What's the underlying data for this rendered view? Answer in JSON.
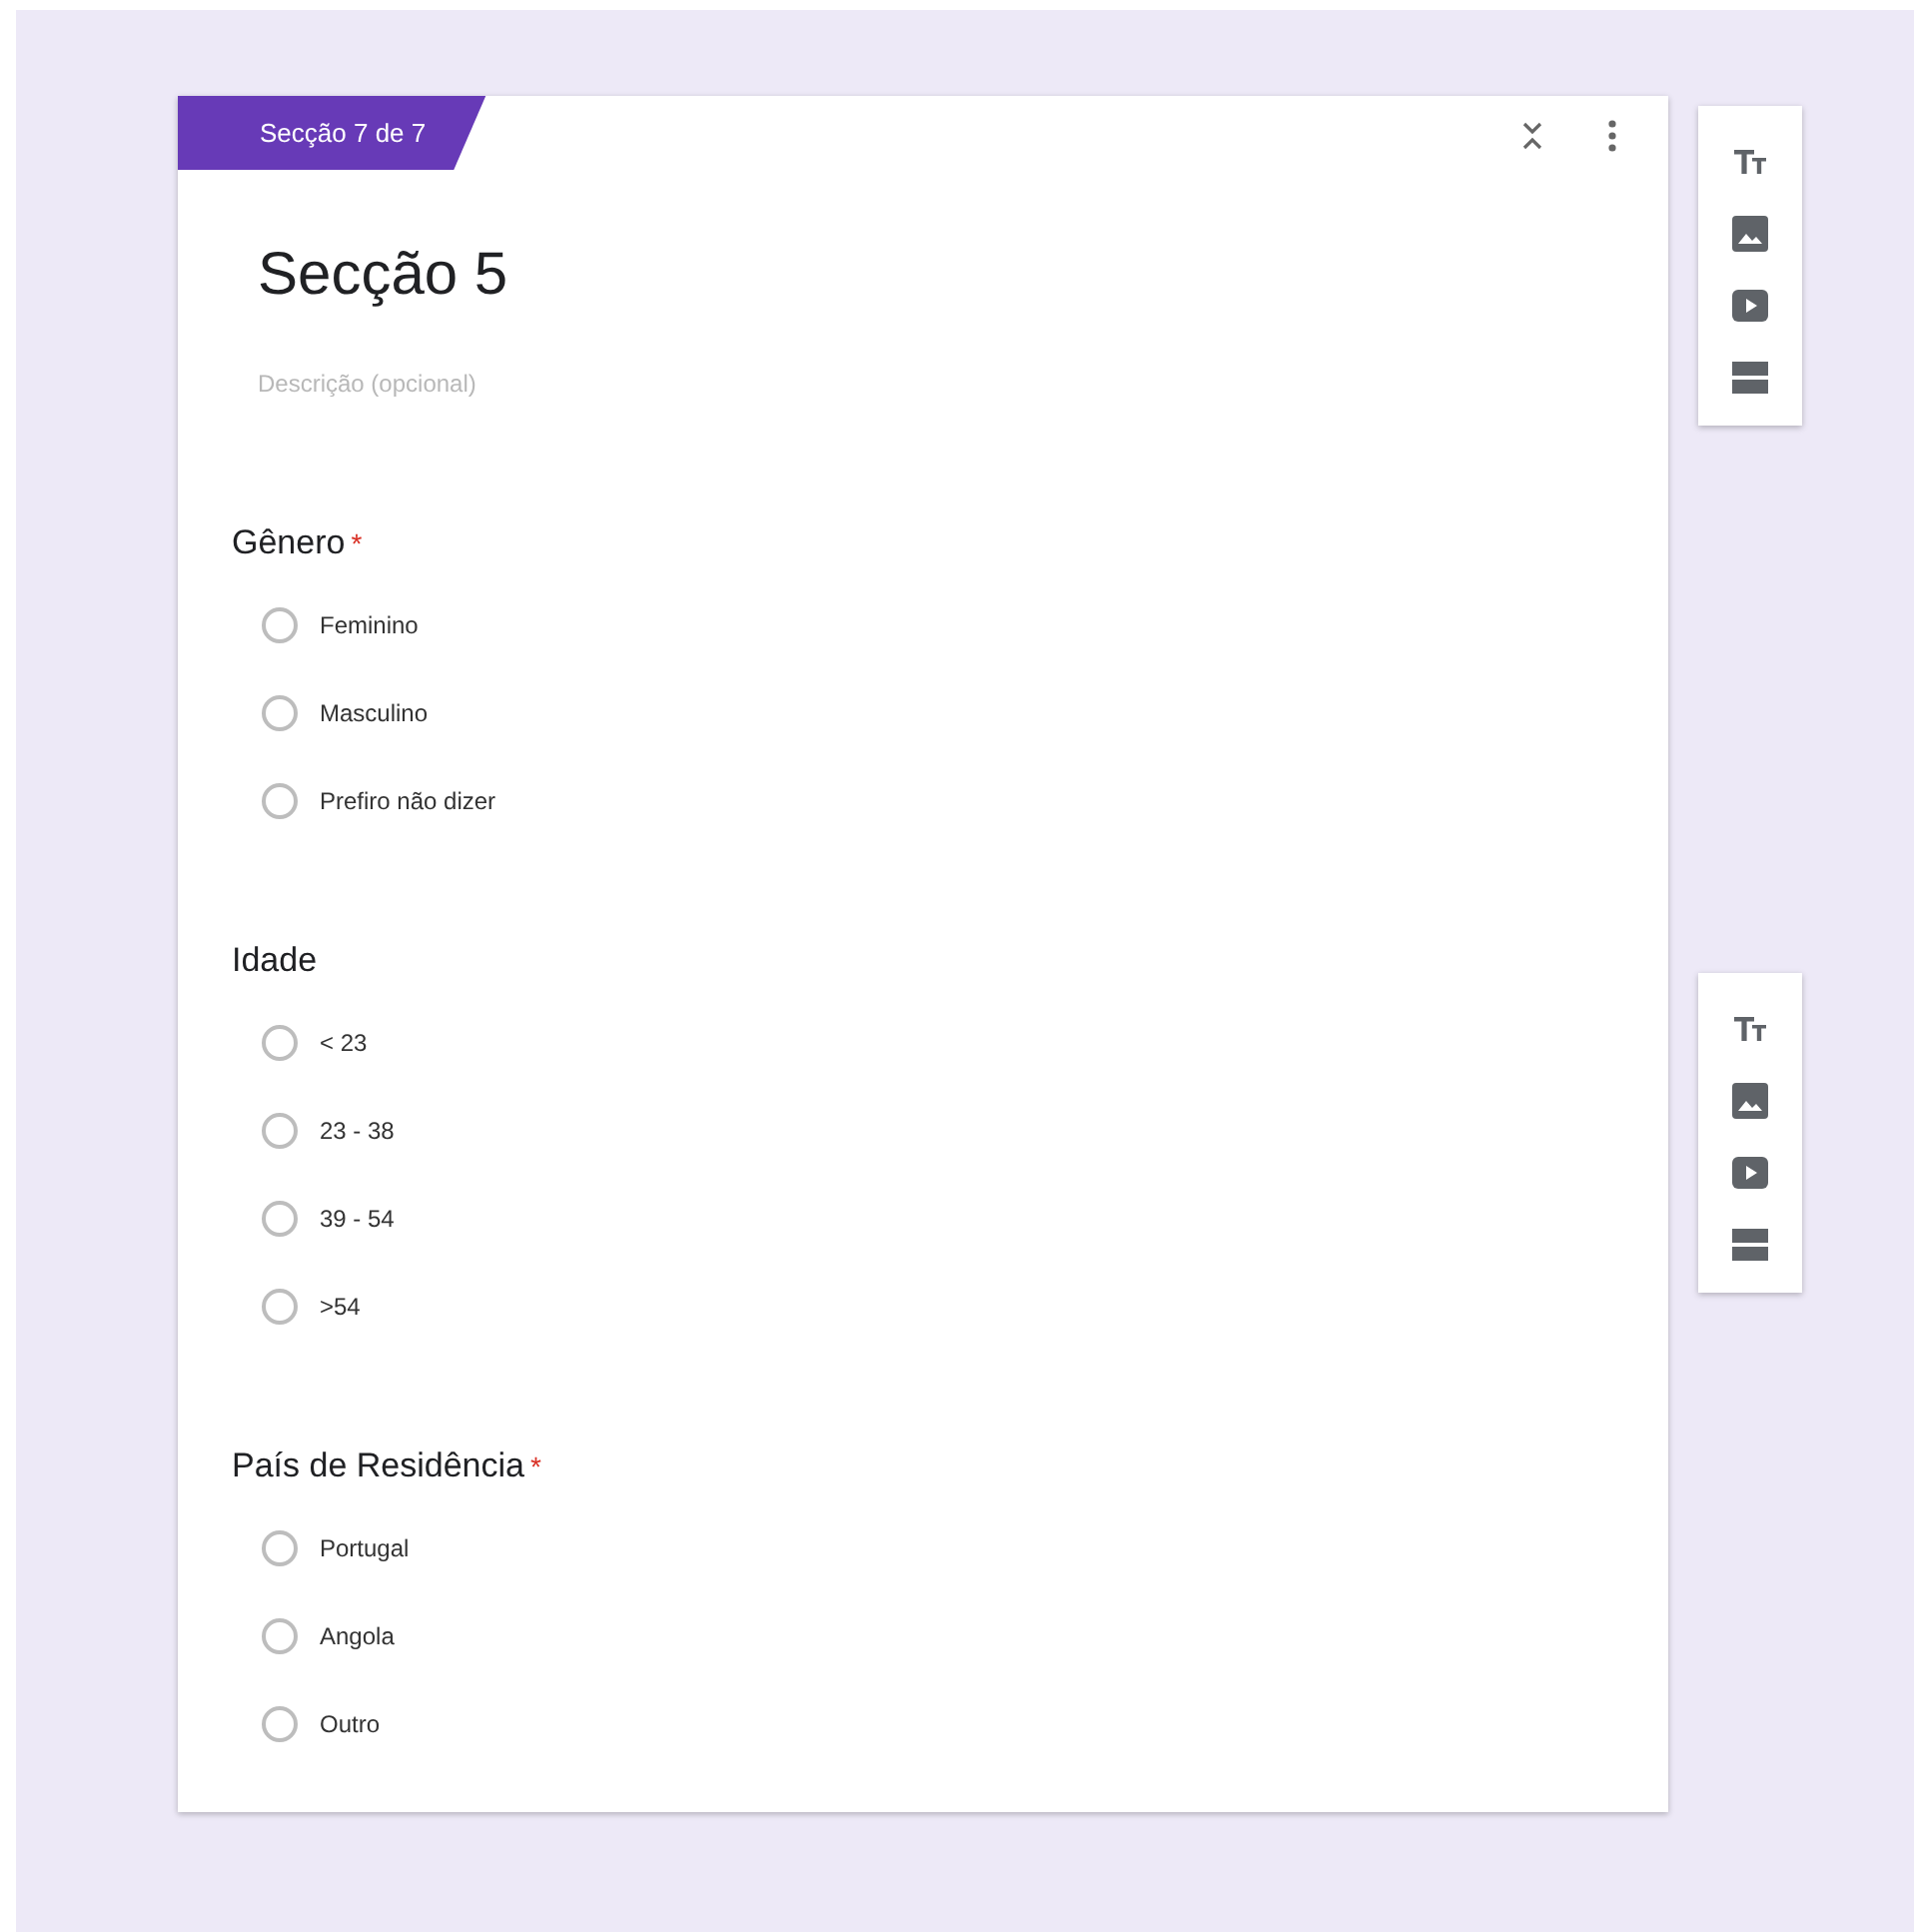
{
  "section_tab": {
    "label": "Secção 7 de 7"
  },
  "section": {
    "title": "Secção 5",
    "description": {
      "placeholder": "Descrição (opcional)"
    }
  },
  "questions": [
    {
      "title": "Gênero",
      "required_mark": "*",
      "options": [
        {
          "label": "Feminino",
          "selected": false
        },
        {
          "label": "Masculino",
          "selected": false
        },
        {
          "label": "Prefiro não dizer",
          "selected": false
        }
      ]
    },
    {
      "title": "Idade",
      "options": [
        {
          "label": "< 23",
          "selected": false
        },
        {
          "label": "23 - 38",
          "selected": false
        },
        {
          "label": "39 - 54",
          "selected": false
        },
        {
          "label": ">54",
          "selected": false
        }
      ]
    },
    {
      "title": "País de Residência",
      "required_mark": "*",
      "options": [
        {
          "label": "Portugal",
          "selected": false
        },
        {
          "label": "Angola",
          "selected": false
        },
        {
          "label": "Outro",
          "selected": false
        }
      ]
    }
  ]
}
